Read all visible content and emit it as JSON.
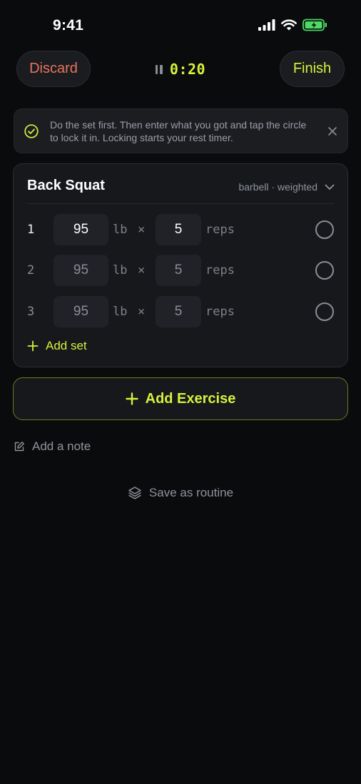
{
  "status_bar": {
    "time": "9:41",
    "icons": [
      "signal-icon",
      "wifi-icon",
      "battery-charging-icon"
    ]
  },
  "top_bar": {
    "discard_label": "Discard",
    "finish_label": "Finish",
    "timer": "0:20",
    "timer_icon": "pause-icon"
  },
  "hint": {
    "text": "Do the set first. Then enter what you got and tap the circle to lock it in. Locking starts your rest timer.",
    "icons": [
      "check-circle-icon",
      "close-icon"
    ]
  },
  "exercise": {
    "name": "Back Squat",
    "meta": "barbell · weighted",
    "weight_unit": "lb",
    "times_symbol": "×",
    "reps_unit": "reps",
    "sets": [
      {
        "number": "1",
        "weight": "95",
        "reps": "5",
        "active": true
      },
      {
        "number": "2",
        "weight": "95",
        "reps": "5",
        "active": false
      },
      {
        "number": "3",
        "weight": "95",
        "reps": "5",
        "active": false
      }
    ],
    "add_set_label": "Add set"
  },
  "actions": {
    "add_exercise_label": "Add Exercise",
    "add_note_label": "Add a note",
    "save_routine_label": "Save as routine"
  },
  "colors": {
    "accent": "#d8f03c",
    "discard": "#e8735f",
    "background": "#0a0b0d",
    "card": "#16181c",
    "battery": "#4cd964"
  }
}
